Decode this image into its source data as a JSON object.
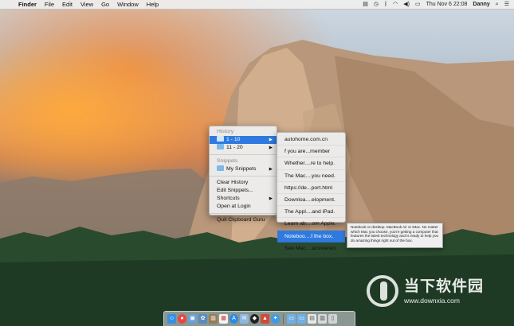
{
  "menubar": {
    "app_name": "Finder",
    "items": [
      "File",
      "Edit",
      "View",
      "Go",
      "Window",
      "Help"
    ],
    "clock": "Thu Nov 6  22:08",
    "user": "Danny"
  },
  "clipboard_menu": {
    "history_header": "History",
    "history_items": [
      {
        "label": "1 - 10",
        "selected": true
      },
      {
        "label": "11 - 20",
        "selected": false
      }
    ],
    "snippets_header": "Snippets",
    "snippets_item": "My Snippets",
    "actions": [
      "Clear History",
      "Edit Snippets...",
      "Shortcuts",
      "Open at Login"
    ],
    "quit": "Quit Clipboard Guru"
  },
  "submenu": {
    "items": [
      "autohome.com.cn",
      "f you are...member",
      "Whether....re to help.",
      "The Mac....you need.",
      "https://de...port.html",
      "Downloa....elopment.",
      "The Appl....and iPad.",
      "Learn ab....om Apple.",
      "Noteboo....f the box.",
      "See Mac....answered."
    ],
    "selected_index": 8
  },
  "tooltip": {
    "text": "Notebook or desktop. MacBook Air or iMac. No matter which Mac you choose, you're getting a computer that features the latest technology and is ready to help you do amazing things right out of the box."
  },
  "watermark": {
    "brand": "当下软件园",
    "url": "www.downxia.com"
  }
}
